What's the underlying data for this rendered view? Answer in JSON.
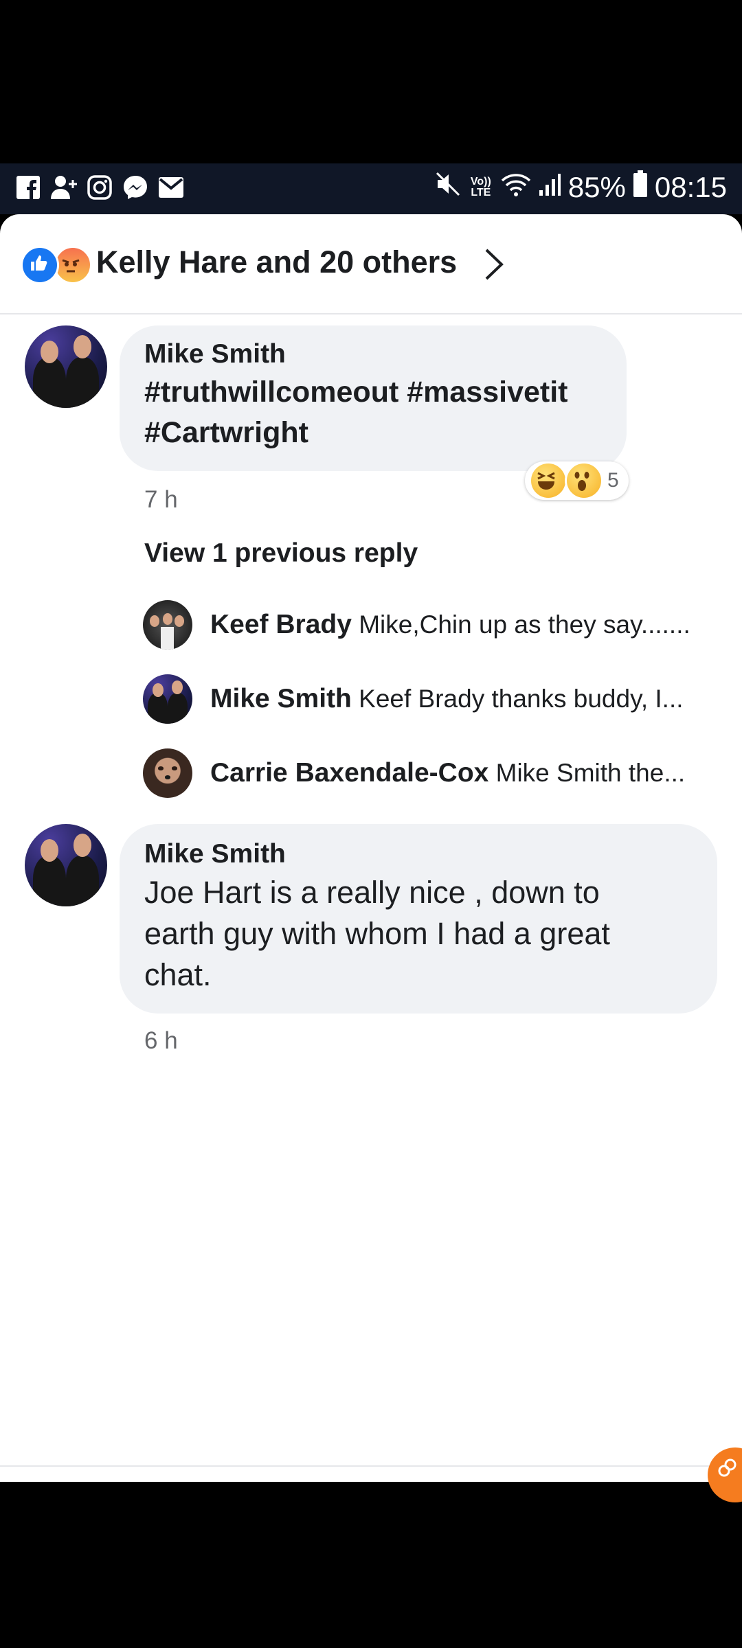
{
  "status_bar": {
    "battery": "85%",
    "time": "08:15",
    "volte": "Vo)) LTE",
    "left_icons": [
      "facebook-icon",
      "friend-request-icon",
      "instagram-icon",
      "messenger-icon",
      "gmail-icon"
    ],
    "right_icons": [
      "mute-icon",
      "volte-icon",
      "wifi-icon",
      "signal-icon",
      "battery-icon"
    ]
  },
  "reactions_header": {
    "reactors_text": "Kelly Hare and 20 others",
    "icons": [
      "like-icon",
      "angry-icon"
    ]
  },
  "comment1": {
    "author": "Mike Smith",
    "lines": [
      "#truthwillcomeout #massivetit",
      "#Cartwright"
    ],
    "time": "7 h",
    "reaction_count": "5",
    "reaction_icons": [
      "haha-icon",
      "wow-icon"
    ]
  },
  "view_previous": "View 1 previous reply",
  "replies": [
    {
      "author": "Keef Brady",
      "text": "Mike,Chin up as they say......."
    },
    {
      "author": "Mike Smith",
      "text": "Keef Brady  thanks buddy, I..."
    },
    {
      "author": "Carrie Baxendale-Cox",
      "text": "Mike Smith the..."
    }
  ],
  "comment2": {
    "author": "Mike Smith",
    "lines": [
      "Joe Hart is a really nice , down to",
      "earth guy with whom I had a great",
      "chat."
    ],
    "time": "6 h"
  },
  "colors": {
    "accent": "#1877f2",
    "bubble": "#f0f2f5",
    "statusbar": "#101727",
    "fab": "#f57c1f"
  }
}
